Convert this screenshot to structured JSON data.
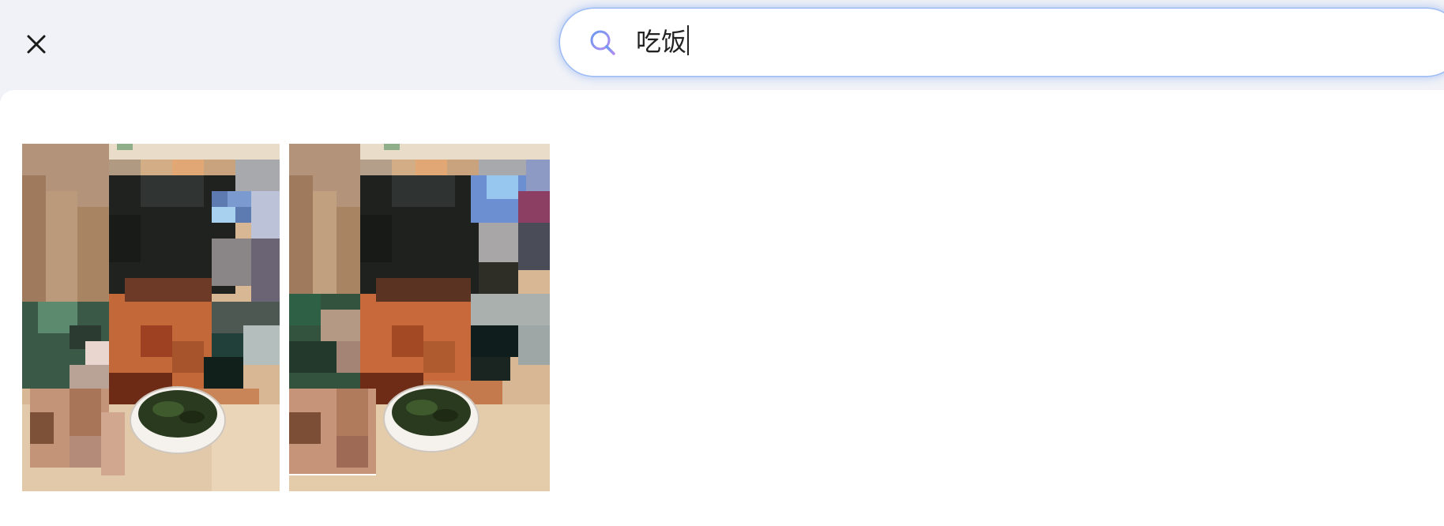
{
  "header": {
    "close_icon": "close-icon",
    "search": {
      "icon": "search-icon",
      "query": "吃饭",
      "accent_color": "#9dbcf5"
    }
  },
  "results": {
    "items": [
      {
        "kind": "photo-thumbnail"
      },
      {
        "kind": "photo-thumbnail"
      }
    ]
  }
}
